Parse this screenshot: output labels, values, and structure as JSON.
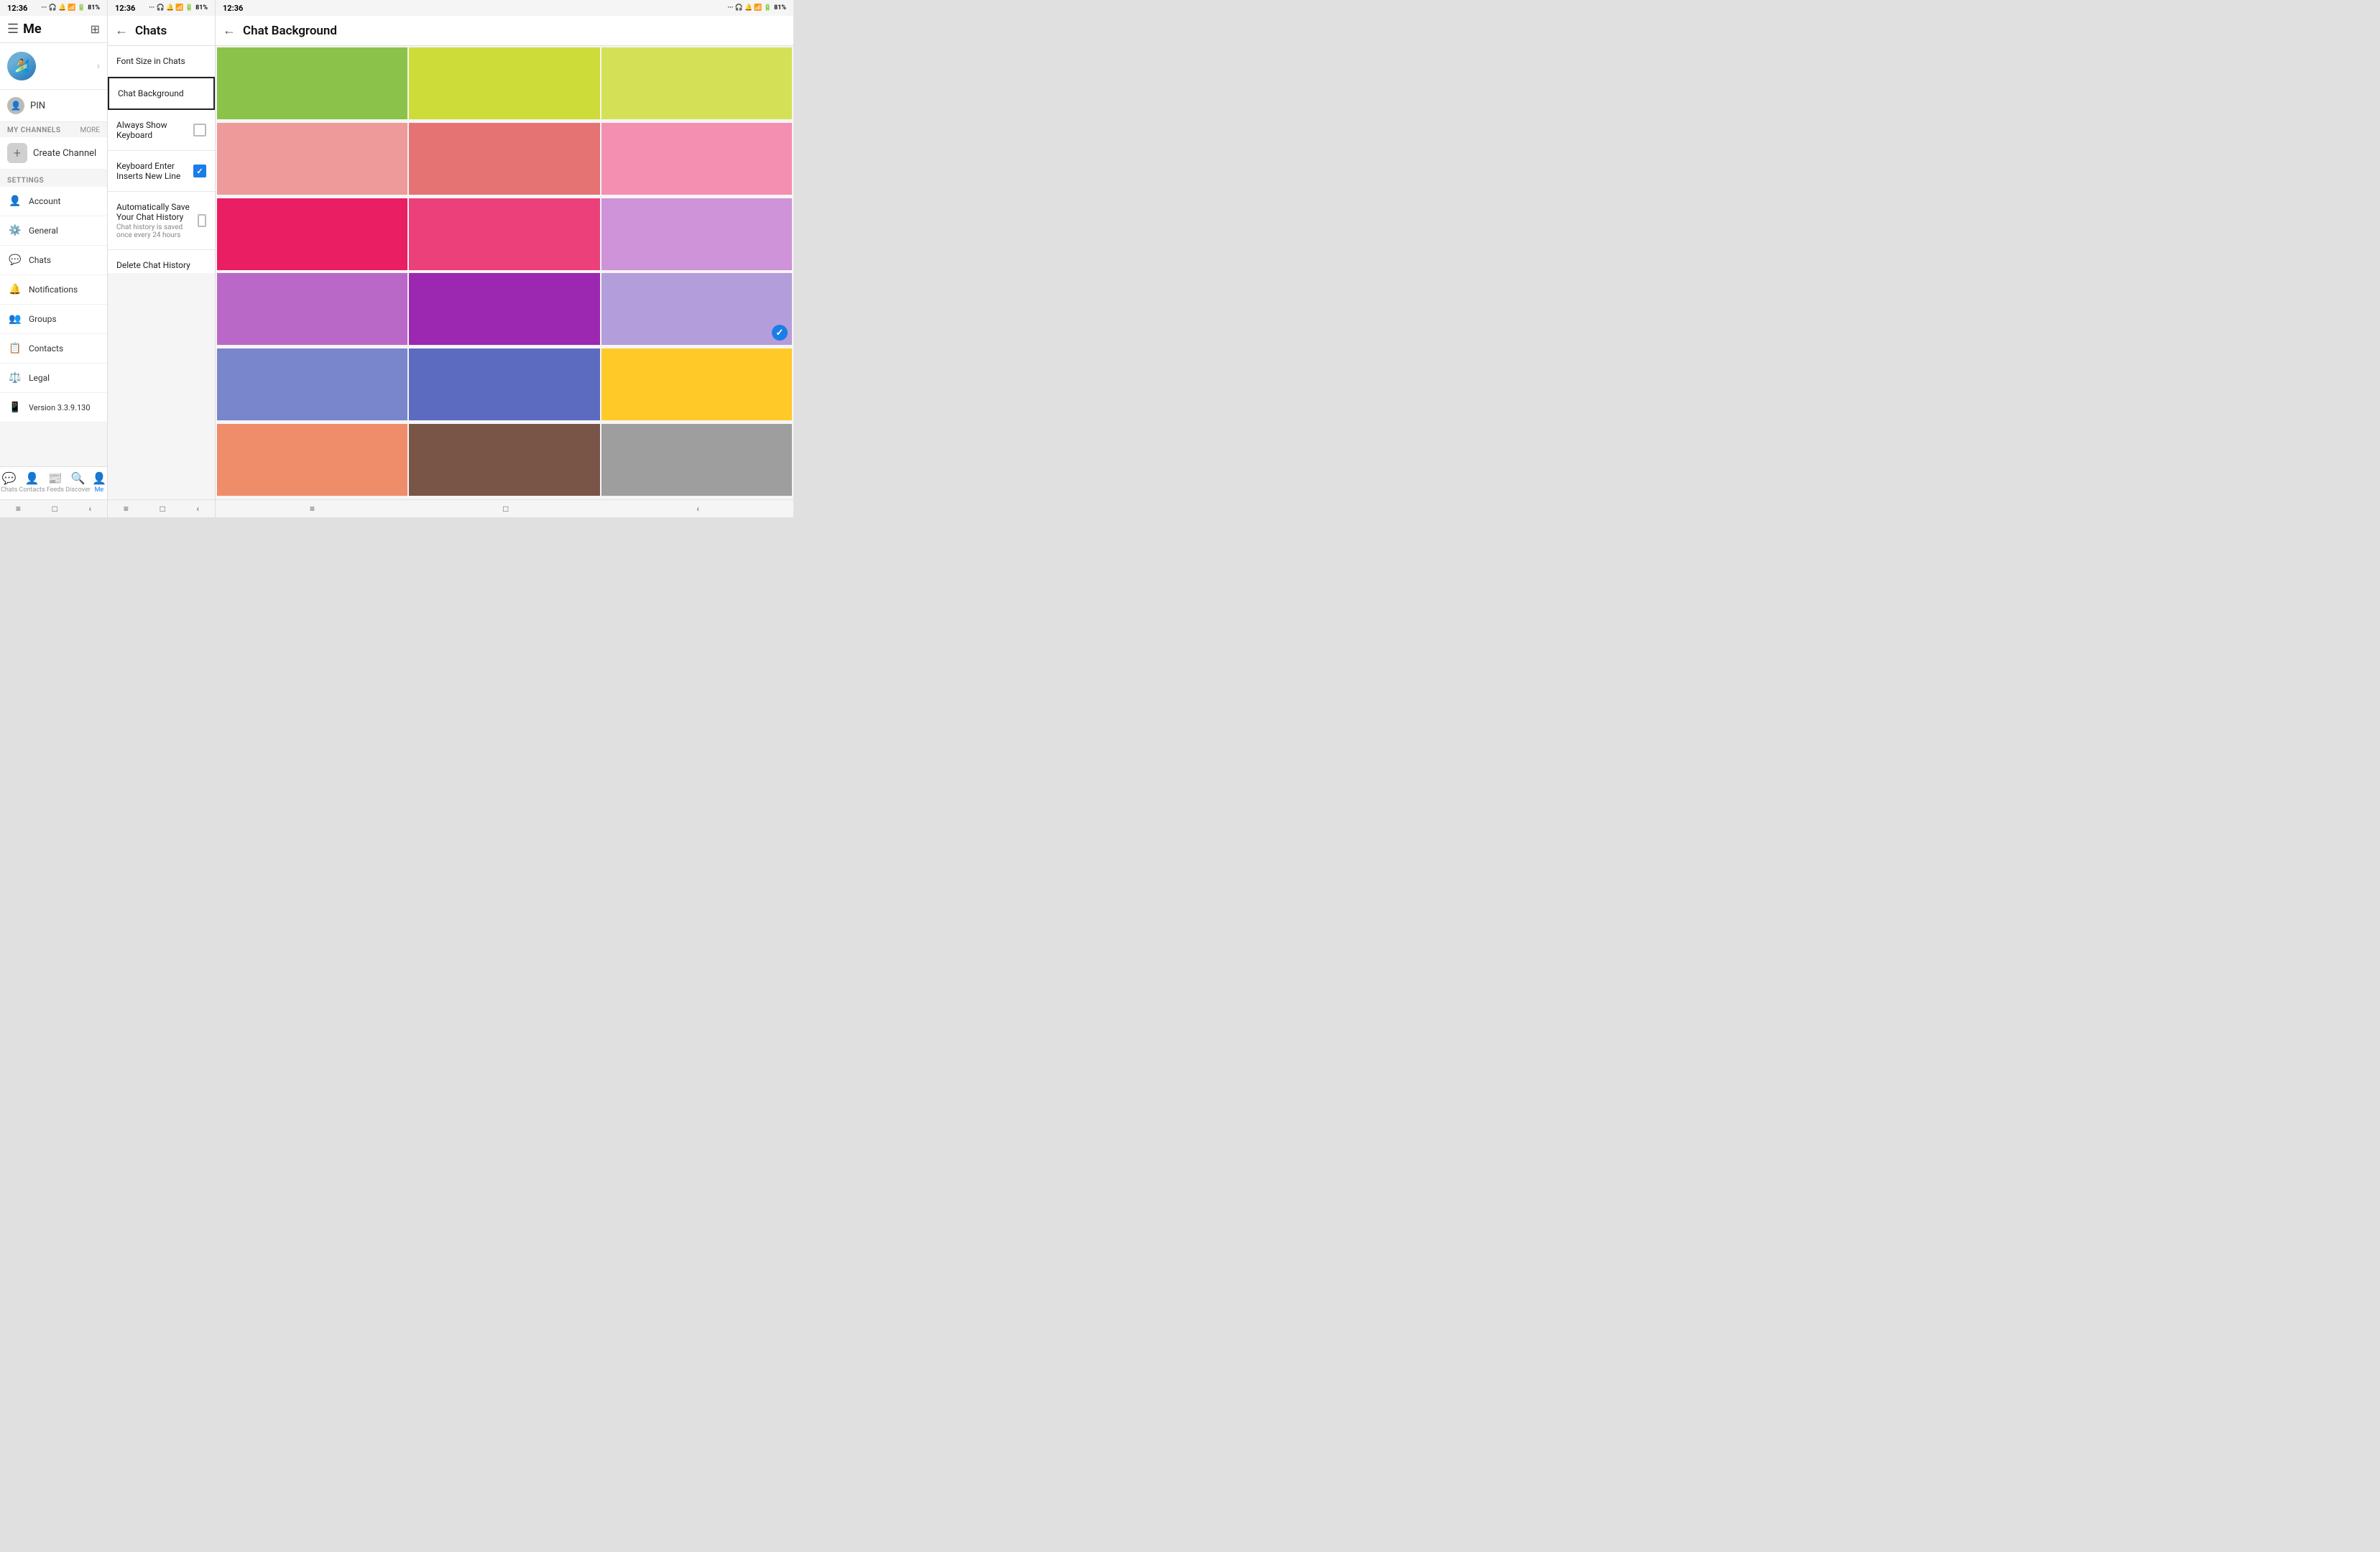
{
  "panel_me": {
    "status_bar": {
      "time": "12:36",
      "battery": "81%"
    },
    "title": "Me",
    "sections": {
      "my_channels": "MY CHANNELS",
      "more": "MORE",
      "settings": "SETTINGS"
    },
    "pin_label": "PIN",
    "create_channel_label": "Create Channel",
    "settings_items": [
      {
        "label": "Account",
        "icon": "👤"
      },
      {
        "label": "General",
        "icon": "⚙️"
      },
      {
        "label": "Chats",
        "icon": "💬"
      },
      {
        "label": "Notifications",
        "icon": "🔔"
      },
      {
        "label": "Groups",
        "icon": "👥"
      },
      {
        "label": "Contacts",
        "icon": "👤"
      },
      {
        "label": "Legal",
        "icon": "⚖️"
      },
      {
        "label": "Version 3.3.9.130",
        "icon": "📱"
      }
    ],
    "bottom_nav": [
      {
        "label": "Chats",
        "icon": "💬",
        "active": false
      },
      {
        "label": "Contacts",
        "icon": "👤",
        "active": false
      },
      {
        "label": "Feeds",
        "icon": "📋",
        "active": false
      },
      {
        "label": "Discover",
        "icon": "🔍",
        "active": false
      },
      {
        "label": "Me",
        "icon": "👤",
        "active": true
      }
    ]
  },
  "panel_chats": {
    "status_bar": {
      "time": "12:36",
      "battery": "81%"
    },
    "title": "Chats",
    "rows": [
      {
        "label": "Font Size in Chats",
        "sub": "",
        "has_checkbox": false,
        "checked": false,
        "highlighted": false
      },
      {
        "label": "Chat Background",
        "sub": "",
        "has_checkbox": false,
        "checked": false,
        "highlighted": true
      },
      {
        "label": "Always Show Keyboard",
        "sub": "",
        "has_checkbox": true,
        "checked": false,
        "highlighted": false
      },
      {
        "label": "Keyboard Enter Inserts New Line",
        "sub": "",
        "has_checkbox": true,
        "checked": true,
        "highlighted": false
      },
      {
        "label": "Automatically Save Your Chat History",
        "sub": "Chat history is saved once every 24 hours",
        "has_checkbox": true,
        "checked": false,
        "highlighted": false
      },
      {
        "label": "Delete Chat History",
        "sub": "",
        "has_checkbox": false,
        "checked": false,
        "highlighted": false
      }
    ],
    "bottom_nav_items": [
      "≡",
      "□",
      "‹"
    ]
  },
  "panel_bg": {
    "status_bar": {
      "time": "12:36",
      "battery": "81%"
    },
    "title": "Chat Background",
    "colors": [
      {
        "color": "#8bc34a",
        "selected": false
      },
      {
        "color": "#cddc39",
        "selected": false
      },
      {
        "color": "#d4e157",
        "selected": false
      },
      {
        "color": "#ef9a9a",
        "selected": false
      },
      {
        "color": "#e57373",
        "selected": false
      },
      {
        "color": "#f48fb1",
        "selected": false
      },
      {
        "color": "#e91e63",
        "selected": false
      },
      {
        "color": "#ec407a",
        "selected": false
      },
      {
        "color": "#ce93d8",
        "selected": false
      },
      {
        "color": "#ba68c8",
        "selected": false
      },
      {
        "color": "#9c27b0",
        "selected": false
      },
      {
        "color": "#b39ddb",
        "selected": true
      },
      {
        "color": "#7986cb",
        "selected": false
      },
      {
        "color": "#5c6bc0",
        "selected": false
      },
      {
        "color": "#ffca28",
        "selected": false
      },
      {
        "color": "#ef8c6a",
        "selected": false
      },
      {
        "color": "#795548",
        "selected": false
      },
      {
        "color": "#9e9e9e",
        "selected": false
      }
    ]
  }
}
